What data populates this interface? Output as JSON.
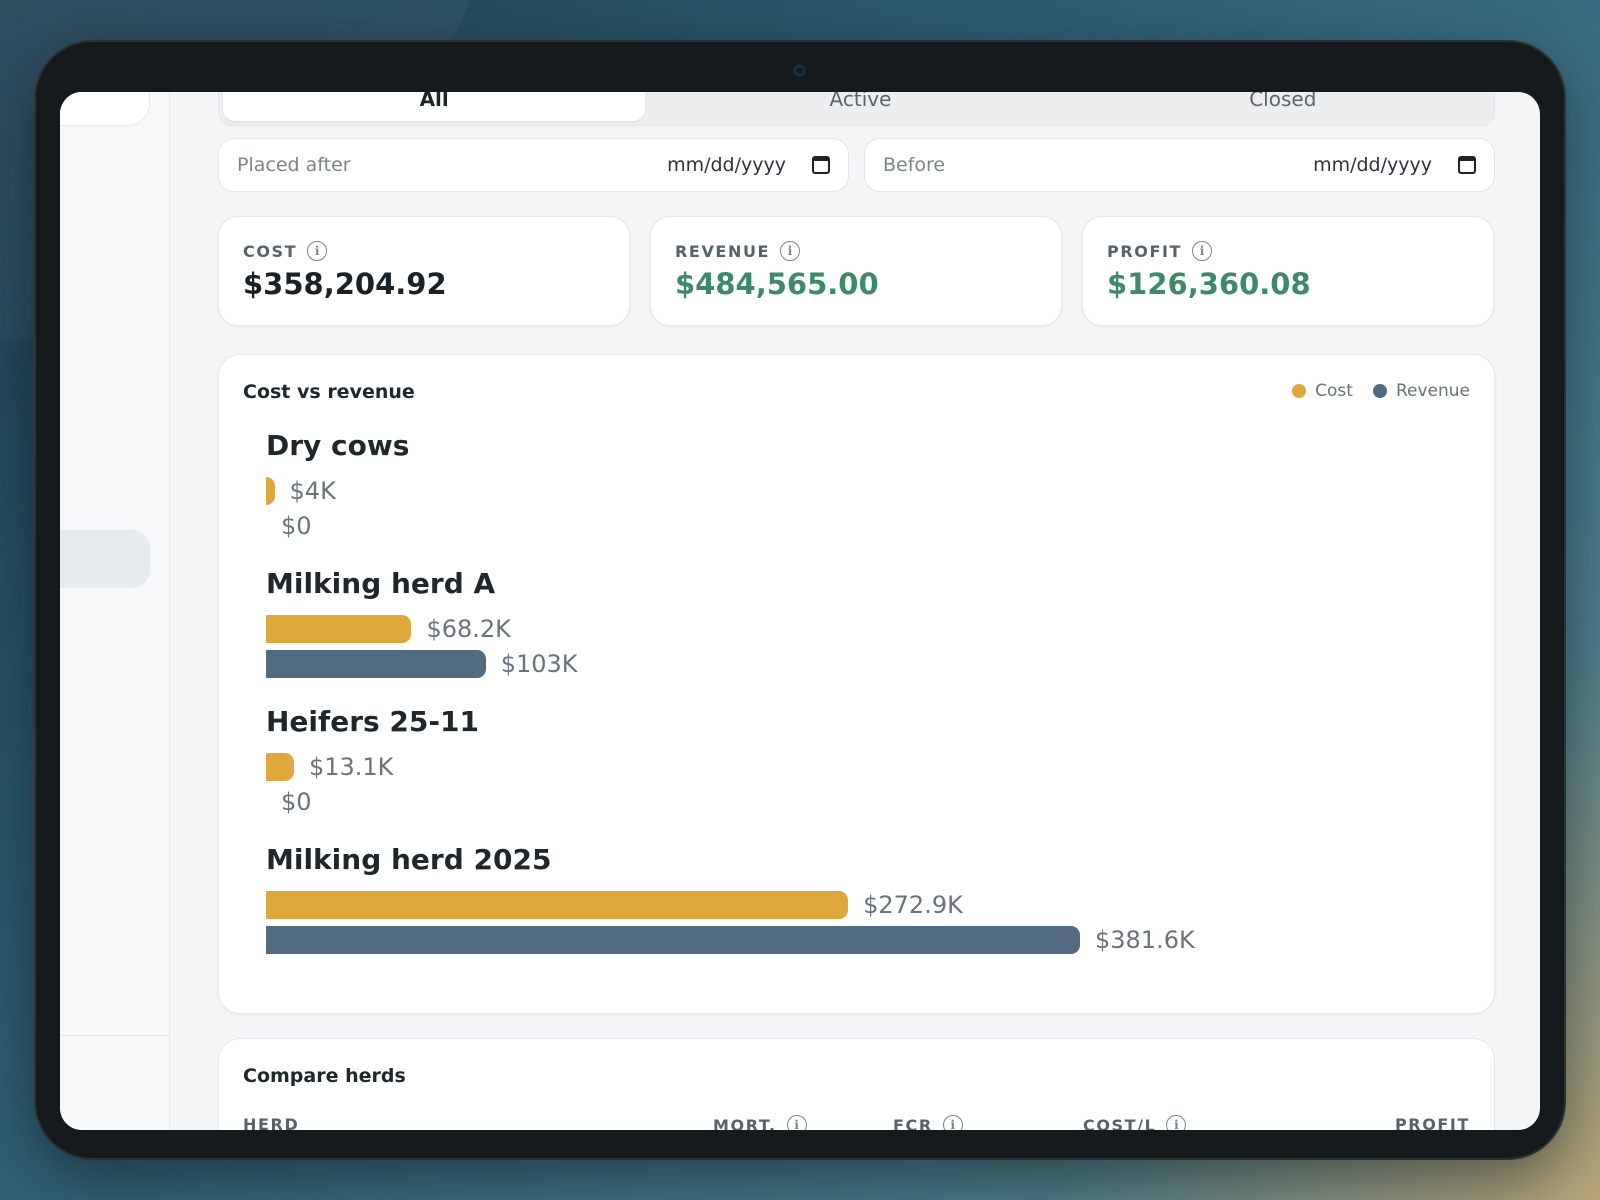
{
  "tabs": [
    {
      "label": "All",
      "active": true
    },
    {
      "label": "Active",
      "active": false
    },
    {
      "label": "Closed",
      "active": false
    }
  ],
  "filters": {
    "after": {
      "label": "Placed after",
      "value": "mm/dd/yyyy"
    },
    "before": {
      "label": "Before",
      "value": "mm/dd/yyyy"
    }
  },
  "stats": {
    "cost": {
      "label": "COST",
      "value": "$358,204.92"
    },
    "revenue": {
      "label": "REVENUE",
      "value": "$484,565.00"
    },
    "profit": {
      "label": "PROFIT",
      "value": "$126,360.08"
    }
  },
  "colors": {
    "cost": "#dfa83c",
    "revenue": "#526b80",
    "positive": "#3d8a68"
  },
  "chart": {
    "title": "Cost vs revenue",
    "legend": [
      {
        "label": "Cost"
      },
      {
        "label": "Revenue"
      }
    ]
  },
  "chart_data": {
    "type": "bar",
    "orientation": "horizontal",
    "title": "Cost vs revenue",
    "categories": [
      "Dry cows",
      "Milking herd A",
      "Heifers 25-11",
      "Milking herd 2025"
    ],
    "series": [
      {
        "name": "Cost",
        "values": [
          4000,
          68200,
          13100,
          272900
        ],
        "labels": [
          "$4K",
          "$68.2K",
          "$13.1K",
          "$272.9K"
        ]
      },
      {
        "name": "Revenue",
        "values": [
          0,
          103000,
          0,
          381600
        ],
        "labels": [
          "$0",
          "$103K",
          "$0",
          "$381.6K"
        ]
      }
    ],
    "legend_position": "top-right",
    "grid": false
  },
  "compare": {
    "title": "Compare herds",
    "columns": [
      "HERD",
      "MORT.",
      "FCR",
      "COST/L",
      "PROFIT"
    ]
  }
}
